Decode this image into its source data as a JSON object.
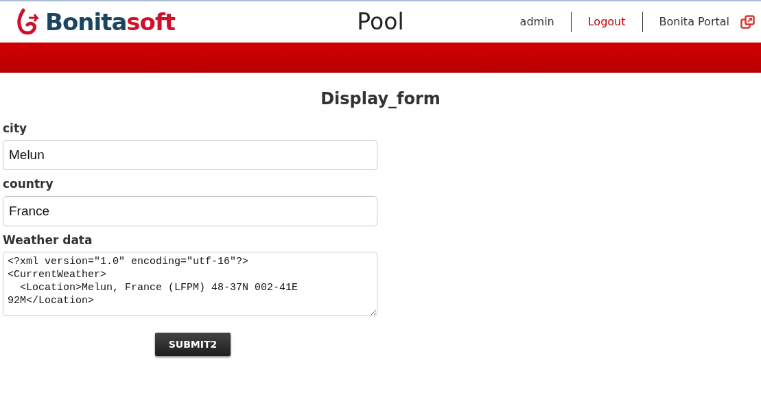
{
  "header": {
    "logo": {
      "main": "Bonita",
      "accent": "soft"
    },
    "title": "Pool",
    "links": [
      {
        "label": "admin",
        "kind": "user"
      },
      {
        "label": "Logout",
        "kind": "logout"
      },
      {
        "label": "Bonita Portal",
        "kind": "portal"
      }
    ]
  },
  "form": {
    "title": "Display_form",
    "fields": [
      {
        "label": "city",
        "kind": "text",
        "value": "Melun"
      },
      {
        "label": "country",
        "kind": "text",
        "value": "France"
      },
      {
        "label": "Weather data",
        "kind": "textarea",
        "value": "<?xml version=\"1.0\" encoding=\"utf-16\"?>\n<CurrentWeather>\n  <Location>Melun, France (LFPM) 48-37N 002-41E 92M</Location>"
      }
    ],
    "submit": "SUBMIT2"
  }
}
